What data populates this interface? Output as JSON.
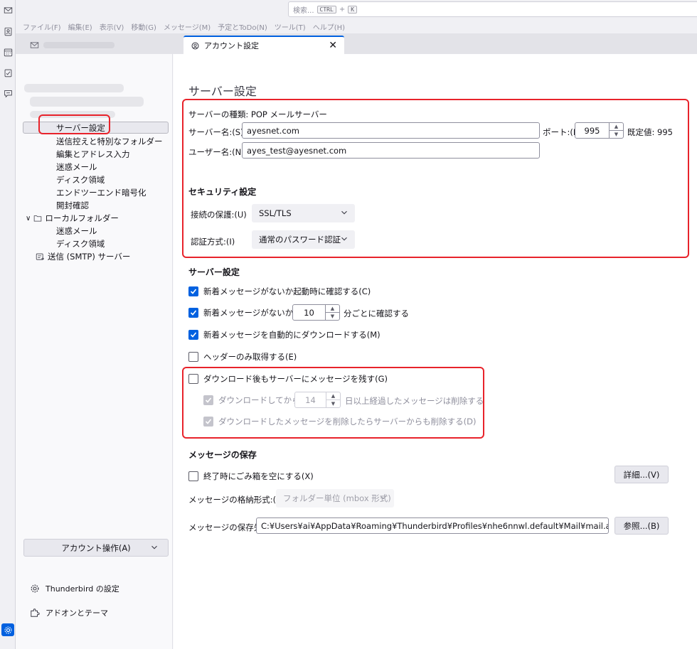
{
  "colors": {
    "accent": "#0060df",
    "highlight_box": "#e8232b"
  },
  "spaces": {
    "icons": [
      "mail-icon",
      "address-book-icon",
      "calendar-icon",
      "tasks-icon",
      "chat-icon",
      "settings-icon"
    ]
  },
  "search": {
    "placeholder": "検索...",
    "key1": "CTRL",
    "plus": "+",
    "key2": "K"
  },
  "menu": [
    "ファイル(F)",
    "編集(E)",
    "表示(V)",
    "移動(G)",
    "メッセージ(M)",
    "予定とToDo(N)",
    "ツール(T)",
    "ヘルプ(H)"
  ],
  "tabs": {
    "active_label": "アカウント設定",
    "close": "✕"
  },
  "sidebar": {
    "items": [
      "サーバー設定",
      "送信控えと特別なフォルダー",
      "編集とアドレス入力",
      "迷惑メール",
      "ディスク領域",
      "エンドツーエンド暗号化",
      "開封確認"
    ],
    "local_folders": "ローカルフォルダー",
    "local_items": [
      "迷惑メール",
      "ディスク領域"
    ],
    "smtp": "送信 (SMTP) サーバー",
    "account_actions": "アカウント操作(A)",
    "settings": "Thunderbird の設定",
    "addons": "アドオンとテーマ"
  },
  "main": {
    "title": "サーバー設定",
    "server_type": "サーバーの種類: POP メールサーバー",
    "server_name_label": "サーバー名:(S)",
    "server_name": "ayesnet.com",
    "port_label": "ポート:(P)",
    "port": "995",
    "default_port": "既定値: 995",
    "username_label": "ユーザー名:(N)",
    "username": "ayes_test@ayesnet.com",
    "security_heading": "セキュリティ設定",
    "connection_security_label": "接続の保護:(U)",
    "connection_security": "SSL/TLS",
    "auth_label": "認証方式:(I)",
    "auth": "通常のパスワード認証",
    "server_settings_heading": "サーバー設定",
    "check_startup": "新着メッセージがないか起動時に確認する(C)",
    "check_every_a": "新着メッセージがないか(Y)",
    "check_every_val": "10",
    "check_every_b": "分ごとに確認する",
    "auto_download": "新着メッセージを自動的にダウンロードする(M)",
    "headers_only": "ヘッダーのみ取得する(E)",
    "leave_on_server": "ダウンロード後もサーバーにメッセージを残す(G)",
    "delete_after_a": "ダウンロードしてから(O)",
    "delete_after_val": "14",
    "delete_after_b": "日以上経過したメッセージは削除する",
    "delete_when_deleted": "ダウンロードしたメッセージを削除したらサーバーからも削除する(D)",
    "storage_heading": "メッセージの保存",
    "empty_trash": "終了時にごみ箱を空にする(X)",
    "advanced_button": "詳細...(V)",
    "store_type_label": "メッセージの格納形式:(T)",
    "store_type": "フォルダー単位 (mbox 形式)",
    "local_dir_label": "メッセージの保存先:",
    "local_dir": "C:¥Users¥ai¥AppData¥Roaming¥Thunderbird¥Profiles¥nhe6nnwl.default¥Mail¥mail.ayesnet.",
    "browse_button": "参照...(B)"
  }
}
